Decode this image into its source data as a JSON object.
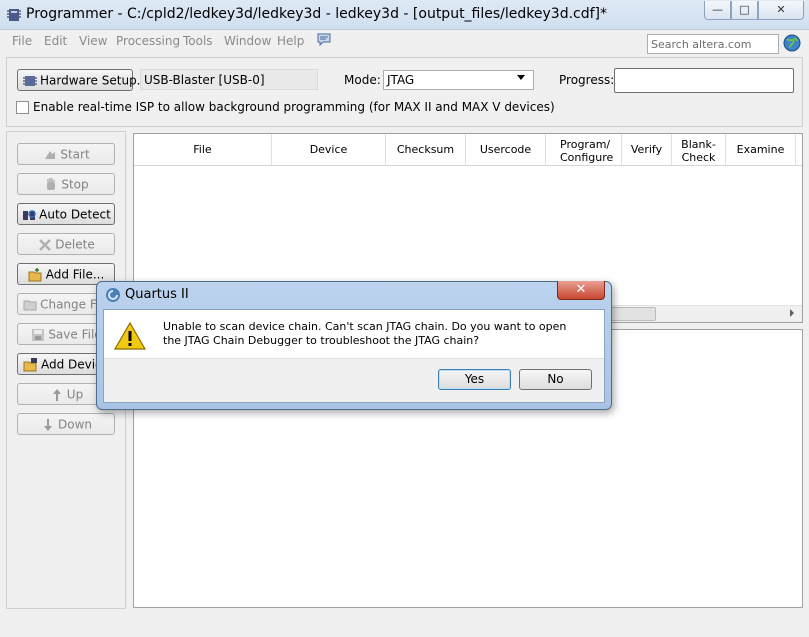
{
  "window": {
    "title": "Programmer - C:/cpld2/ledkey3d/ledkey3d - ledkey3d - [output_files/ledkey3d.cdf]*",
    "min_glyph": "—",
    "max_glyph": "□",
    "close_glyph": "✕"
  },
  "menu": [
    "File",
    "Edit",
    "View",
    "Processing",
    "Tools",
    "Window",
    "Help"
  ],
  "search": {
    "placeholder": "Search altera.com"
  },
  "hardware": {
    "button_label": "Hardware Setup...",
    "value": "USB-Blaster [USB-0]",
    "mode_label": "Mode:",
    "mode_value": "JTAG",
    "progress_label": "Progress:"
  },
  "isp": {
    "label": "Enable real-time ISP to allow background programming (for MAX II and MAX V devices)"
  },
  "side_buttons": [
    {
      "label": "Start",
      "enabled": false
    },
    {
      "label": "Stop",
      "enabled": false
    },
    {
      "label": "Auto Detect",
      "enabled": true
    },
    {
      "label": "Delete",
      "enabled": false
    },
    {
      "label": "Add File...",
      "enabled": true
    },
    {
      "label": "Change File",
      "enabled": false
    },
    {
      "label": "Save File",
      "enabled": false
    },
    {
      "label": "Add Device",
      "enabled": true
    },
    {
      "label": "Up",
      "enabled": false
    },
    {
      "label": "Down",
      "enabled": false
    }
  ],
  "table": {
    "columns": [
      "File",
      "Device",
      "Checksum",
      "Usercode",
      "Program/ Configure",
      "Verify",
      "Blank- Check",
      "Examine"
    ]
  },
  "dialog": {
    "title": "Quartus II",
    "message": "Unable to scan device chain. Can't scan JTAG chain. Do you want to open the JTAG Chain Debugger to troubleshoot the JTAG chain?",
    "yes_label": "Yes",
    "no_label": "No",
    "close_glyph": "✕"
  },
  "colors": {
    "titlebar": "#d5e3f3",
    "dialog_frame": "#b1cae8",
    "close_red": "#c8462f",
    "warning_yellow": "#f2c811"
  }
}
